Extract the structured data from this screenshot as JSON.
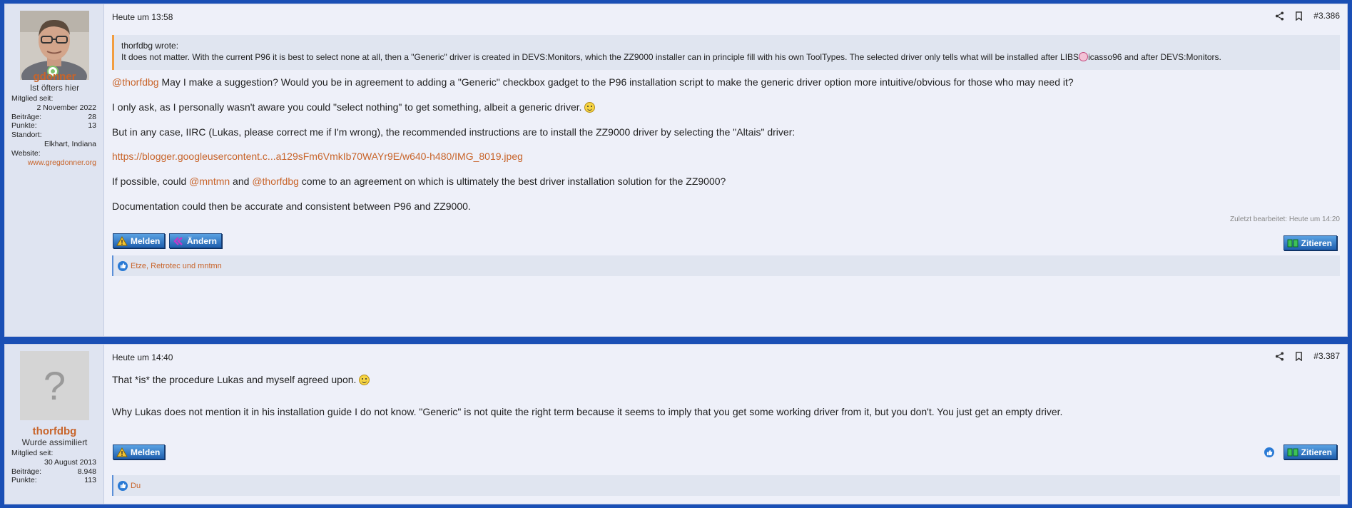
{
  "posts": [
    {
      "time": "Heute um 13:58",
      "post_number": "#3.386",
      "user": {
        "name": "gdonner",
        "title": "Ist öfters hier",
        "member_since_label": "Mitglied seit:",
        "member_since": "2 November 2022",
        "posts_label": "Beiträge:",
        "posts": "28",
        "points_label": "Punkte:",
        "points": "13",
        "location_label": "Standort:",
        "location": "Elkhart, Indiana",
        "website_label": "Website:",
        "website": "www.gregdonner.org"
      },
      "quote": {
        "author": "thorfdbg wrote:",
        "text_before": "It does not matter. With the current P96 it is best to select none at all, then a \"Generic\" driver is created in DEVS:Monitors, which the ZZ9000 installer can in principle fill with his own ToolTypes. The selected driver only tells what will be installed after LIBS",
        "text_after": "icasso96 and after DEVS:Monitors."
      },
      "body": {
        "p1_mention": "@thorfdbg",
        "p1_text": " May I make a suggestion? Would you be in agreement to adding a \"Generic\" checkbox gadget to the P96 installation script to make the generic driver option more intuitive/obvious for those who may need it?",
        "p2_text": "I only ask, as I personally wasn't aware you could \"select nothing\" to get something, albeit a generic driver. ",
        "p3_text": "But in any case, IIRC (Lukas, please correct me if I'm wrong), the recommended instructions are to install the ZZ9000 driver by selecting the \"Altais\" driver:",
        "p4_link": "https://blogger.googleusercontent.c...a129sFm6VmkIb70WAYr9E/w640-h480/IMG_8019.jpeg",
        "p5_a": "If possible, could ",
        "p5_mention1": "@mntmn",
        "p5_b": " and ",
        "p5_mention2": "@thorfdbg",
        "p5_c": " come to an agreement on which is ultimately the best driver installation solution for the ZZ9000?",
        "p6_text": "Documentation could then be accurate and consistent between P96 and ZZ9000."
      },
      "edited": "Zuletzt bearbeitet: Heute um 14:20",
      "buttons": {
        "report": "Melden",
        "edit": "Ändern",
        "quote": "Zitieren"
      },
      "likes": "Etze, Retrotec und mntmn"
    },
    {
      "time": "Heute um 14:40",
      "post_number": "#3.387",
      "user": {
        "name": "thorfdbg",
        "title": "Wurde assimiliert",
        "avatar_letter": "?",
        "member_since_label": "Mitglied seit:",
        "member_since": "30 August 2013",
        "posts_label": "Beiträge:",
        "posts": "8.948",
        "points_label": "Punkte:",
        "points": "113"
      },
      "body": {
        "p1_text": "That *is* the procedure Lukas and myself agreed upon. ",
        "p2_text": "Why Lukas does not mention it in his installation guide I do not know. \"Generic\" is not quite the right term because it seems to imply that you get some working driver from it, but you don't. You just get an empty driver."
      },
      "buttons": {
        "report": "Melden",
        "quote": "Zitieren"
      },
      "likes": "Du"
    }
  ],
  "colors": {
    "background": "#1a4fb5",
    "accent": "#c8642a",
    "quote_border": "#f29d3f"
  },
  "icons": [
    "share-icon",
    "bookmark-icon",
    "warning-icon",
    "edit-icon",
    "quote-icon",
    "like-icon",
    "online-status-icon"
  ]
}
